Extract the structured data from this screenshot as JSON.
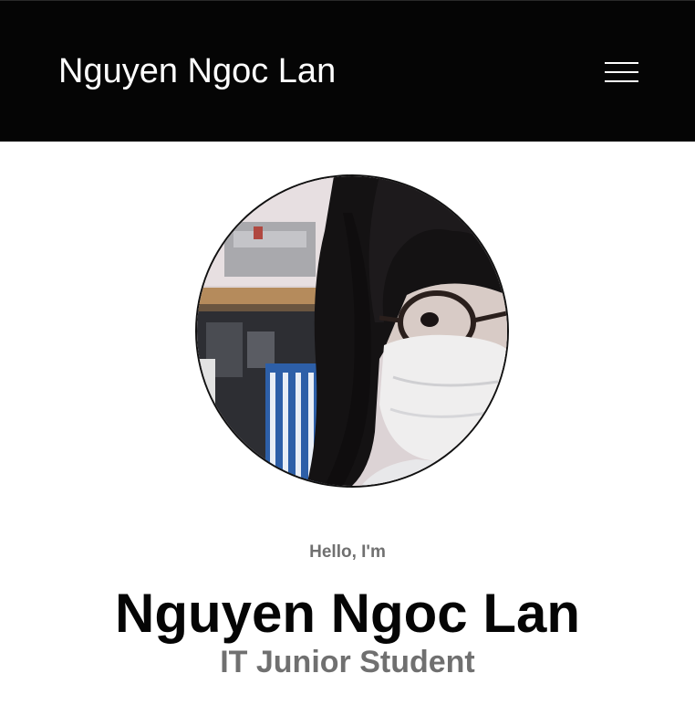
{
  "header": {
    "brand": "Nguyen Ngoc Lan",
    "menu_icon": "hamburger-menu-icon"
  },
  "profile": {
    "photo": "profile-photo",
    "greeting": "Hello, I'm",
    "name": "Nguyen Ngoc Lan",
    "role": "IT Junior Student"
  },
  "colors": {
    "header_background": "#050505",
    "header_text": "#ffffff",
    "page_background": "#ffffff",
    "name_text": "#050505",
    "muted_text": "#707070"
  }
}
